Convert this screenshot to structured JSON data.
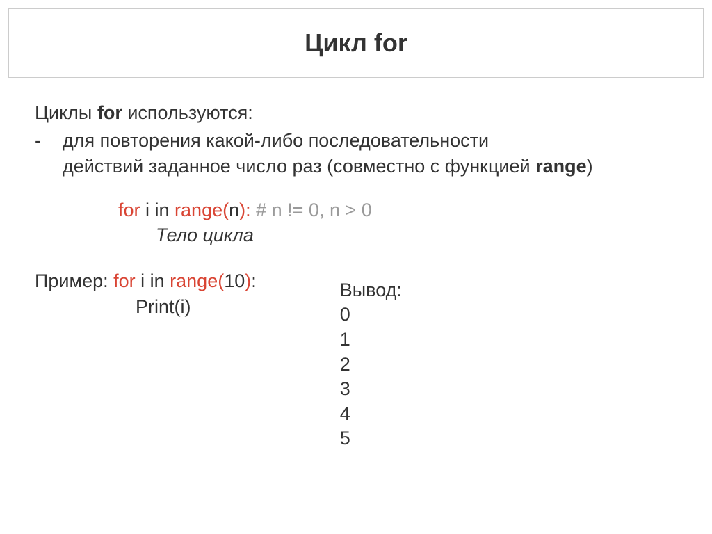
{
  "title": "Цикл for",
  "intro": {
    "prefix": "Циклы ",
    "bold": "for",
    "suffix": " используются:"
  },
  "bullet": {
    "dash": "-",
    "line1": "для повторения какой-либо последовательности",
    "line2_prefix": "действий заданное число раз (совместно с функцией ",
    "line2_bold": "range",
    "line2_suffix": ")"
  },
  "syntax": {
    "for": "for",
    "i_in": " i  in ",
    "range": "range(",
    "n": "n",
    "paren_colon": "):",
    "comment": "    # n != 0, n > 0",
    "body": "Тело цикла"
  },
  "example": {
    "label": "Пример:  ",
    "for": "for",
    "i_in": " i  in ",
    "range": "range(",
    "ten": "10",
    "paren": ")",
    "colon": ":",
    "print": "Print(i)"
  },
  "output": {
    "label": "Вывод:",
    "lines": [
      "0",
      "1",
      "2",
      "3",
      "4",
      "5"
    ]
  }
}
